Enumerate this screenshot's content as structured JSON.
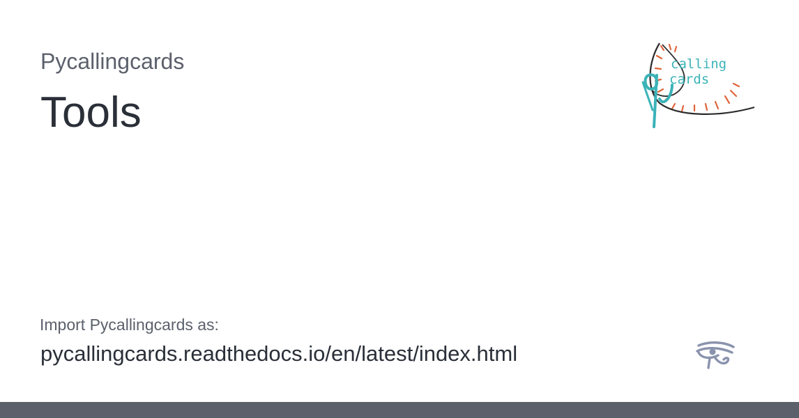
{
  "header": {
    "project_name": "Pycallingcards",
    "title": "Tools"
  },
  "logo": {
    "icon": "pycallingcards-logo-icon",
    "text_line1": "calling",
    "text_line2": "cards",
    "colors": {
      "teal": "#3bb3b8",
      "orange": "#e0643a",
      "dark": "#2b2b2b"
    }
  },
  "footer_info": {
    "import_label": "Import Pycallingcards as:",
    "url": "pycallingcards.readthedocs.io/en/latest/index.html",
    "eye_icon": "eye-of-horus-icon",
    "eye_color": "#8a93ad"
  },
  "footer_bar": {
    "color": "#5b606b"
  }
}
